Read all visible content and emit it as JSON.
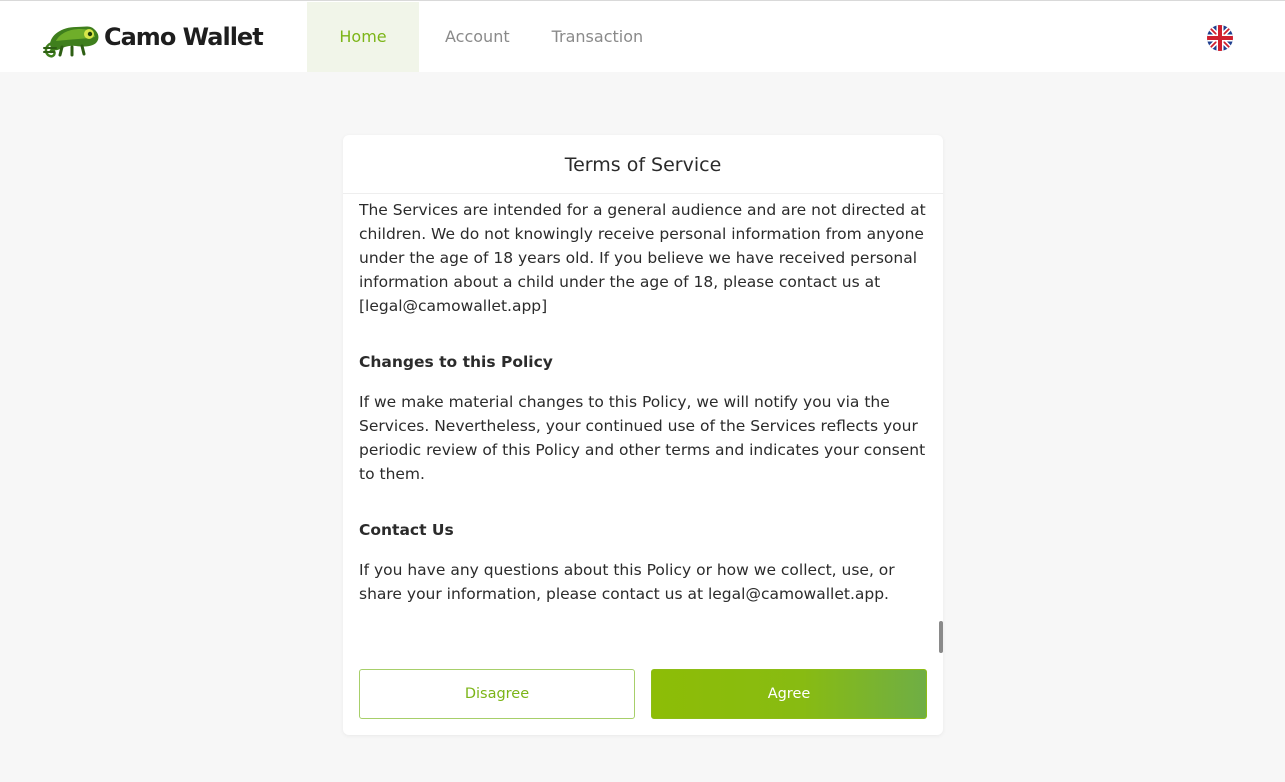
{
  "brand": {
    "name": "Camo Wallet",
    "accent_color": "#7cb518"
  },
  "nav": {
    "items": [
      {
        "label": "Home",
        "active": true
      },
      {
        "label": "Account",
        "active": false
      },
      {
        "label": "Transaction",
        "active": false
      }
    ]
  },
  "language": {
    "icon": "uk-flag-icon"
  },
  "modal": {
    "title": "Terms of Service",
    "paragraph_children": "The Services are intended for a general audience and are not directed at children. We do not knowingly receive personal information from anyone under the age of 18 years old. If you believe we have received personal information about a child under the age of 18, please contact us at [legal@camowallet.app]",
    "heading_changes": "Changes to this Policy",
    "paragraph_changes": "If we make material changes to this Policy, we will notify you via the Services. Nevertheless, your continued use of the Services reflects your periodic review of this Policy and other terms and indicates your consent to them.",
    "heading_contact": "Contact Us",
    "paragraph_contact": "If you have any questions about this Policy or how we collect, use, or share your information, please contact us at legal@camowallet.app.",
    "disagree_label": "Disagree",
    "agree_label": "Agree"
  }
}
